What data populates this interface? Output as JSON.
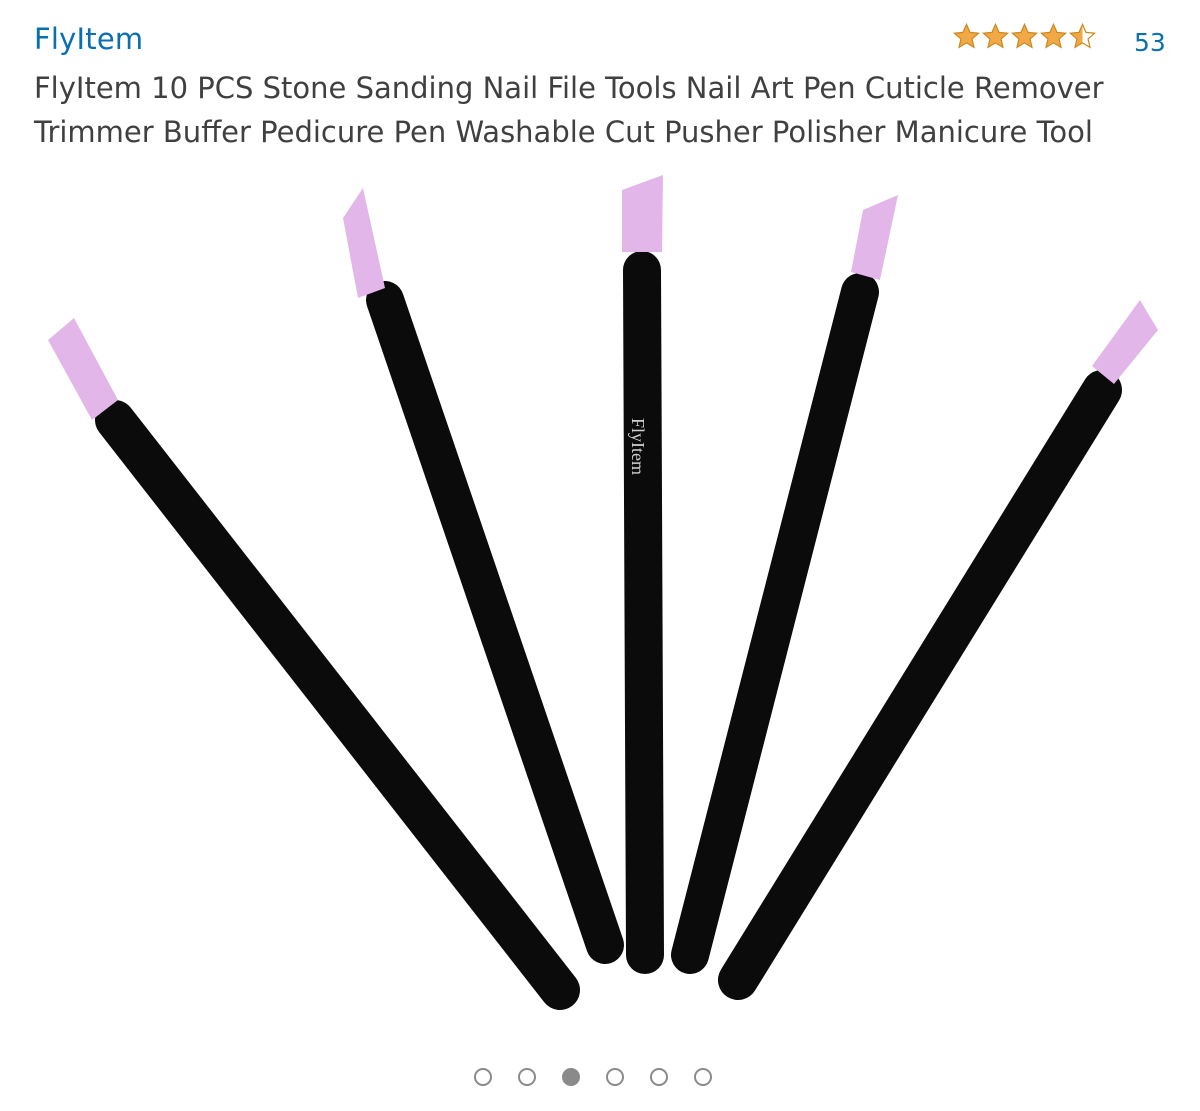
{
  "product": {
    "brand": "FlyItem",
    "title": "FlyItem 10 PCS Stone Sanding Nail File Tools Nail Art Pen Cuticle Remover Trimmer Buffer Pedicure Pen Washable Cut Pusher Polisher Manicure Tool",
    "rating": 4.5,
    "rating_max": 5,
    "review_count": "53",
    "image_imprint": "FlyItem"
  },
  "carousel": {
    "total": 6,
    "active_index": 2
  },
  "colors": {
    "link": "#0a6fb0",
    "star": "#f3a847",
    "star_outline": "#c98a1e",
    "title_text": "#404040",
    "handle": "#0b0b0b",
    "tip": "#e3b6ea"
  },
  "icons": {
    "star_full": "star-icon",
    "star_half": "star-half-icon",
    "dot": "carousel-dot-icon"
  }
}
